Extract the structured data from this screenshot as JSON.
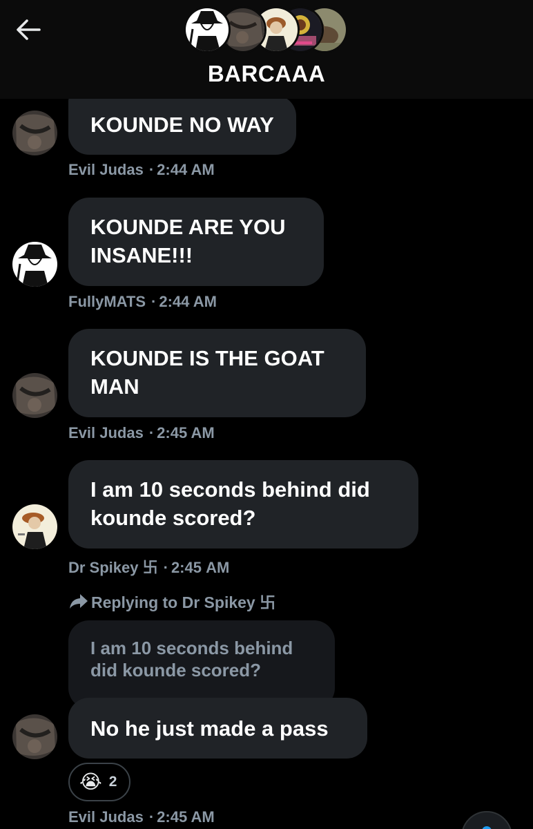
{
  "header": {
    "title": "BARCAAA"
  },
  "messages": [
    {
      "sender": "Evil Judas",
      "text": "KOUNDE NO WAY",
      "time": "2:44 AM",
      "avatar": "dark-photo-avatar"
    },
    {
      "sender": "FullyMATS",
      "text": "KOUNDE ARE YOU INSANE!!!",
      "time": "2:44 AM",
      "avatar": "sketch-figure-avatar"
    },
    {
      "sender": "Evil Judas",
      "text": "KOUNDE IS THE GOAT MAN",
      "time": "2:45 AM",
      "avatar": "dark-photo-avatar"
    },
    {
      "sender": "Dr Spikey 卐",
      "text": "I am 10 seconds behind did kounde scored?",
      "time": "2:45 AM",
      "avatar": "cartoon-figure-avatar"
    },
    {
      "sender": "Evil Judas",
      "text": "No he just made a pass",
      "time": "2:45 AM",
      "avatar": "dark-photo-avatar",
      "reply": {
        "label": "Replying to Dr Spikey 卐",
        "quoted_text": "I am 10 seconds behind did kounde scored?"
      },
      "reaction": {
        "emoji": "😭",
        "count": "2"
      }
    }
  ],
  "colors": {
    "background": "#000000",
    "header_background": "#0b0b0b",
    "bubble": "#202327",
    "quoted_bubble": "#16181c",
    "meta_text": "#8b98a5",
    "accent": "#1d9bf0"
  },
  "icons": {
    "back": "arrow-left-icon",
    "reply": "reply-arrow-icon"
  }
}
